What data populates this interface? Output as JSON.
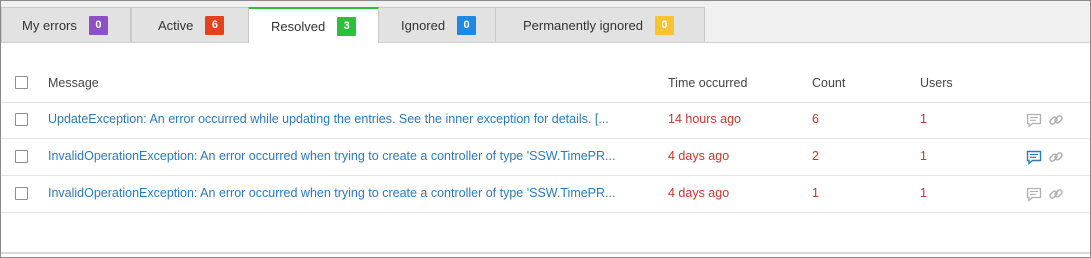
{
  "tabs": [
    {
      "label": "My errors",
      "count": "0",
      "color": "#8e4ec6"
    },
    {
      "label": "Active",
      "count": "6",
      "color": "#e8401c"
    },
    {
      "label": "Resolved",
      "count": "3",
      "color": "#2bbf3a",
      "active": true
    },
    {
      "label": "Ignored",
      "count": "0",
      "color": "#1e88e5"
    },
    {
      "label": "Permanently ignored",
      "count": "0",
      "color": "#f5c431"
    }
  ],
  "table": {
    "headers": {
      "message": "Message",
      "time": "Time occurred",
      "count": "Count",
      "users": "Users"
    },
    "rows": [
      {
        "message": "UpdateException: An error occurred while updating the entries. See the inner exception for details. [...",
        "time": "14 hours ago",
        "count": "6",
        "users": "1",
        "comment_active": false
      },
      {
        "message": "InvalidOperationException: An error occurred when trying to create a controller of type 'SSW.TimePR...",
        "time": "4 days ago",
        "count": "2",
        "users": "1",
        "comment_active": true
      },
      {
        "message": "InvalidOperationException: An error occurred when trying to create a controller of type 'SSW.TimePR...",
        "time": "4 days ago",
        "count": "1",
        "users": "1",
        "comment_active": false
      }
    ]
  },
  "icons": {
    "comment": "comment-icon",
    "link": "link-icon"
  },
  "colors": {
    "link": "#2a7ac0",
    "value": "#c0392b",
    "icon_idle": "#b0b0b0",
    "icon_active": "#2a7ac0"
  }
}
